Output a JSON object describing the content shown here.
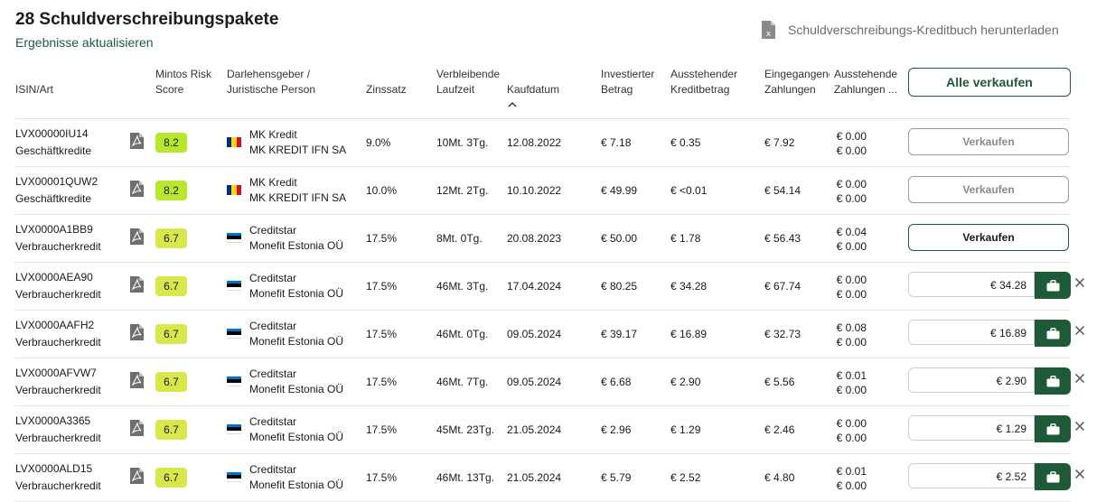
{
  "page": {
    "title": "28 Schuldverschreibungspakete",
    "refresh_label": "Ergebnisse aktualisieren",
    "download_label": "Schuldverschreibungs-Kreditbuch herunterladen",
    "sell_all_label": "Alle verkaufen"
  },
  "columns": {
    "isin": "ISIN/Art",
    "risk_1": "Mintos Risk",
    "risk_2": "Score",
    "lender_1": "Darlehensgeber /",
    "lender_2": "Juristische Person",
    "rate": "Zinssatz",
    "term_1": "Verbleibende",
    "term_2": "Laufzeit",
    "date": "Kaufdatum",
    "invested_1": "Investierter",
    "invested_2": "Betrag",
    "outstanding_1": "Ausstehender",
    "outstanding_2": "Kreditbetrag",
    "received_1": "Eingegangene",
    "received_2": "Zahlungen",
    "due_1": "Ausstehende",
    "due_2": "Zahlungen ..."
  },
  "colors": {
    "accent": "#1f5a38",
    "score_high": "#b8e82e",
    "score_mid": "#d8e84a"
  },
  "rows": [
    {
      "isin": "LVX00000IU14",
      "type": "Geschäftkredite",
      "score": "8.2",
      "flag": "ro",
      "lender": "MK Kredit",
      "entity": "MK KREDIT IFN SA",
      "rate": "9.0%",
      "term": "10Mt. 3Tg.",
      "date": "12.08.2022",
      "invested": "€ 7.18",
      "outstanding": "€ 0.35",
      "received": "€ 7.92",
      "due_a": "€ 0.00",
      "due_b": "€ 0.00",
      "action": "button",
      "button_label": "Verkaufen",
      "button_enabled": false
    },
    {
      "isin": "LVX00001QUW2",
      "type": "Geschäftkredite",
      "score": "8.2",
      "flag": "ro",
      "lender": "MK Kredit",
      "entity": "MK KREDIT IFN SA",
      "rate": "10.0%",
      "term": "12Mt. 2Tg.",
      "date": "10.10.2022",
      "invested": "€ 49.99",
      "outstanding": "€ <0.01",
      "received": "€ 54.14",
      "due_a": "€ 0.00",
      "due_b": "€ 0.00",
      "action": "button",
      "button_label": "Verkaufen",
      "button_enabled": false
    },
    {
      "isin": "LVX0000A1BB9",
      "type": "Verbraucherkredit",
      "score": "6.7",
      "flag": "ee",
      "lender": "Creditstar",
      "entity": "Monefit Estonia OÜ",
      "rate": "17.5%",
      "term": "8Mt. 0Tg.",
      "date": "20.08.2023",
      "invested": "€ 50.00",
      "outstanding": "€ 1.78",
      "received": "€ 56.43",
      "due_a": "€ 0.04",
      "due_b": "€ 0.00",
      "action": "button",
      "button_label": "Verkaufen",
      "button_enabled": true
    },
    {
      "isin": "LVX0000AEA90",
      "type": "Verbraucherkredit",
      "score": "6.7",
      "flag": "ee",
      "lender": "Creditstar",
      "entity": "Monefit Estonia OÜ",
      "rate": "17.5%",
      "term": "46Mt. 3Tg.",
      "date": "17.04.2024",
      "invested": "€ 80.25",
      "outstanding": "€ 34.28",
      "received": "€ 67.74",
      "due_a": "€ 0.00",
      "due_b": "€ 0.00",
      "action": "input",
      "price": "€ 34.28"
    },
    {
      "isin": "LVX0000AAFH2",
      "type": "Verbraucherkredit",
      "score": "6.7",
      "flag": "ee",
      "lender": "Creditstar",
      "entity": "Monefit Estonia OÜ",
      "rate": "17.5%",
      "term": "46Mt. 0Tg.",
      "date": "09.05.2024",
      "invested": "€ 39.17",
      "outstanding": "€ 16.89",
      "received": "€ 32.73",
      "due_a": "€ 0.08",
      "due_b": "€ 0.00",
      "action": "input",
      "price": "€ 16.89"
    },
    {
      "isin": "LVX0000AFVW7",
      "type": "Verbraucherkredit",
      "score": "6.7",
      "flag": "ee",
      "lender": "Creditstar",
      "entity": "Monefit Estonia OÜ",
      "rate": "17.5%",
      "term": "46Mt. 7Tg.",
      "date": "09.05.2024",
      "invested": "€ 6.68",
      "outstanding": "€ 2.90",
      "received": "€ 5.56",
      "due_a": "€ 0.01",
      "due_b": "€ 0.00",
      "action": "input",
      "price": "€ 2.90"
    },
    {
      "isin": "LVX0000A3365",
      "type": "Verbraucherkredit",
      "score": "6.7",
      "flag": "ee",
      "lender": "Creditstar",
      "entity": "Monefit Estonia OÜ",
      "rate": "17.5%",
      "term": "45Mt. 23Tg.",
      "date": "21.05.2024",
      "invested": "€ 2.96",
      "outstanding": "€ 1.29",
      "received": "€ 2.46",
      "due_a": "€ 0.00",
      "due_b": "€ 0.00",
      "action": "input",
      "price": "€ 1.29"
    },
    {
      "isin": "LVX0000ALD15",
      "type": "Verbraucherkredit",
      "score": "6.7",
      "flag": "ee",
      "lender": "Creditstar",
      "entity": "Monefit Estonia OÜ",
      "rate": "17.5%",
      "term": "46Mt. 13Tg.",
      "date": "21.05.2024",
      "invested": "€ 5.79",
      "outstanding": "€ 2.52",
      "received": "€ 4.80",
      "due_a": "€ 0.01",
      "due_b": "€ 0.00",
      "action": "input",
      "price": "€ 2.52"
    }
  ]
}
